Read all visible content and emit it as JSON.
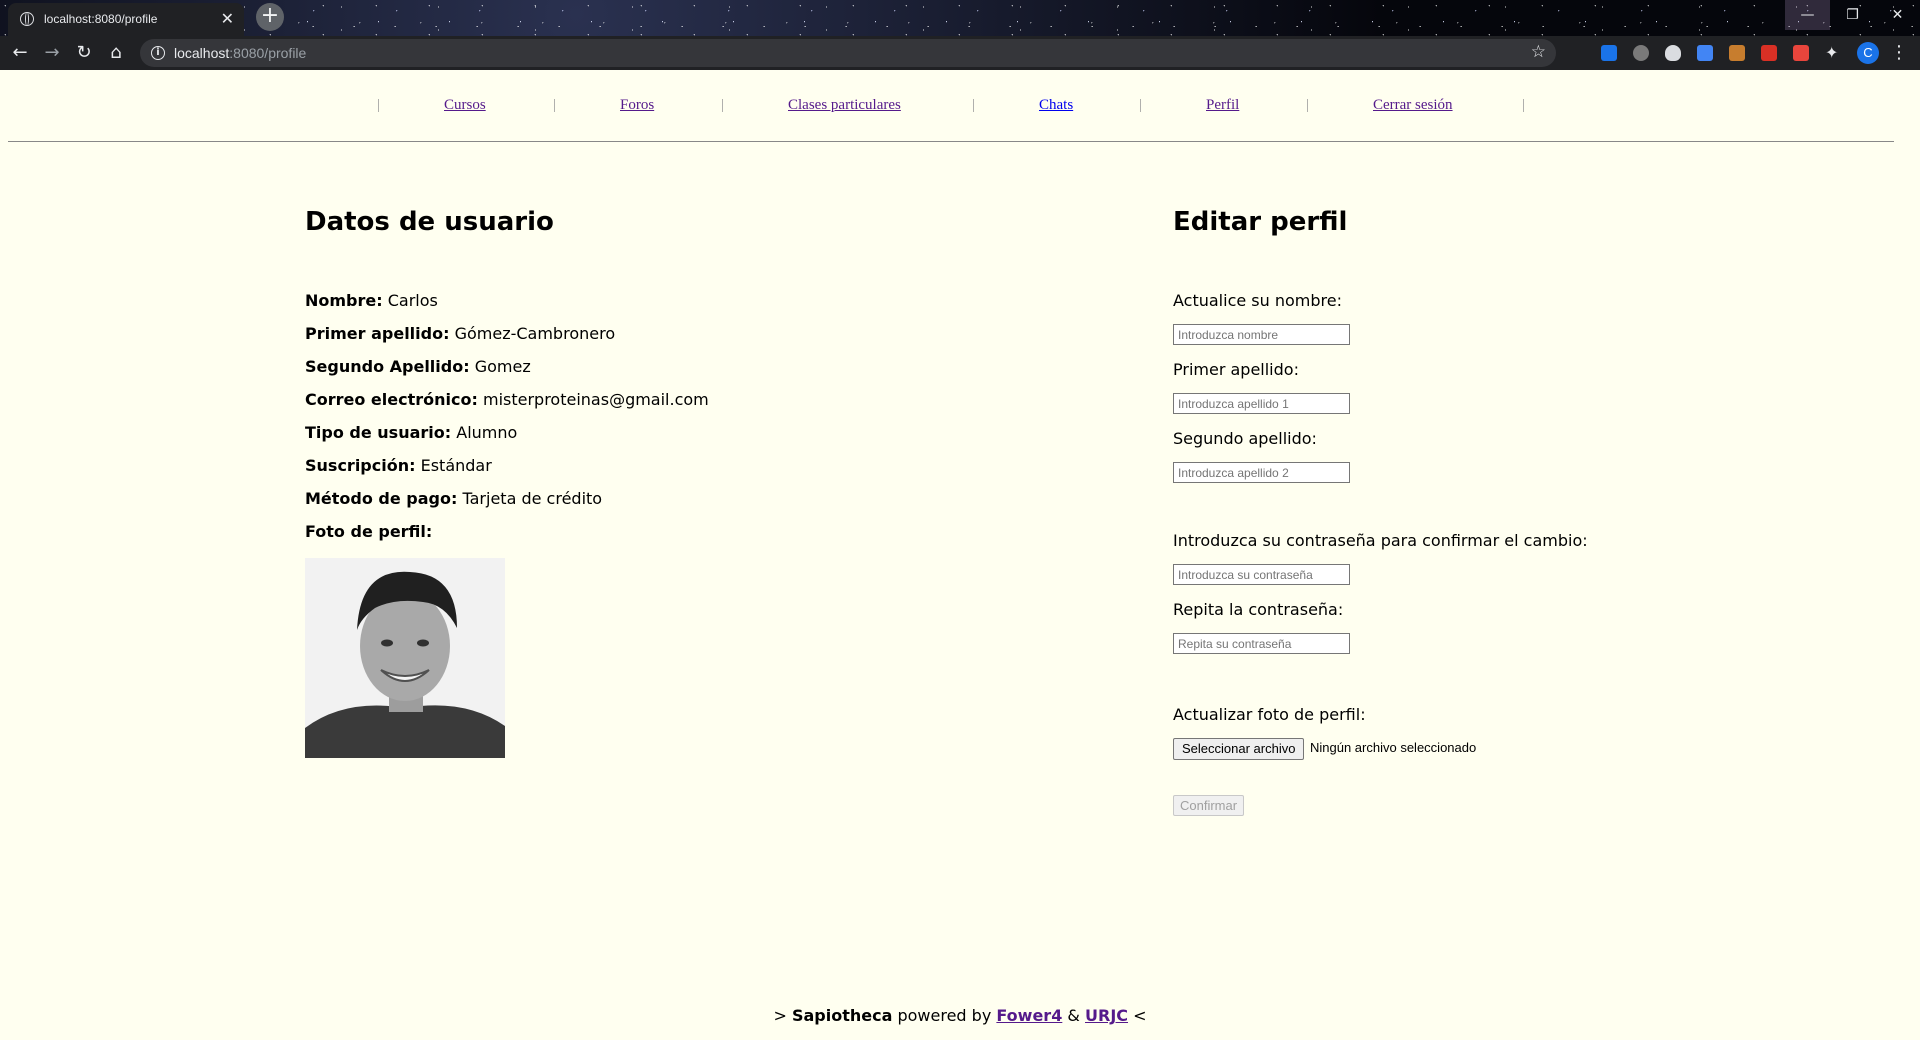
{
  "browser": {
    "tab_title": "localhost:8080/profile",
    "url_host": "localhost",
    "url_path": ":8080/profile",
    "profile_initial": "C"
  },
  "nav": {
    "items": [
      {
        "label": "Cursos"
      },
      {
        "label": "Foros"
      },
      {
        "label": "Clases particulares"
      },
      {
        "label": "Chats"
      },
      {
        "label": "Perfil"
      },
      {
        "label": "Cerrar sesión"
      }
    ],
    "separator": "|"
  },
  "user_data": {
    "heading": "Datos de usuario",
    "fields": [
      {
        "label": "Nombre:",
        "value": "Carlos"
      },
      {
        "label": "Primer apellido:",
        "value": "Gómez-Cambronero"
      },
      {
        "label": "Segundo Apellido:",
        "value": "Gomez"
      },
      {
        "label": "Correo electrónico:",
        "value": "misterproteinas@gmail.com"
      },
      {
        "label": "Tipo de usuario:",
        "value": "Alumno"
      },
      {
        "label": "Suscripción:",
        "value": "Estándar"
      },
      {
        "label": "Método de pago:",
        "value": "Tarjeta de crédito"
      },
      {
        "label": "Foto de perfil:",
        "value": ""
      }
    ]
  },
  "edit_profile": {
    "heading": "Editar perfil",
    "name_label": "Actualice su nombre:",
    "name_placeholder": "Introduzca nombre",
    "surname1_label": "Primer apellido:",
    "surname1_placeholder": "Introduzca apellido 1",
    "surname2_label": "Segundo apellido:",
    "surname2_placeholder": "Introduzca apellido 2",
    "password_label": "Introduzca su contraseña para confirmar el cambio:",
    "password_placeholder": "Introduzca su contraseña",
    "repeat_label": "Repita la contraseña:",
    "repeat_placeholder": "Repita su contraseña",
    "photo_label": "Actualizar foto de perfil:",
    "file_button": "Seleccionar archivo",
    "file_status": "Ningún archivo seleccionado",
    "confirm_button": "Confirmar"
  },
  "footer": {
    "prefix": ">",
    "brand": "Sapiotheca",
    "powered": "powered by",
    "link1": "Fower4",
    "amp": "&",
    "link2": "URJC",
    "suffix": "<"
  }
}
